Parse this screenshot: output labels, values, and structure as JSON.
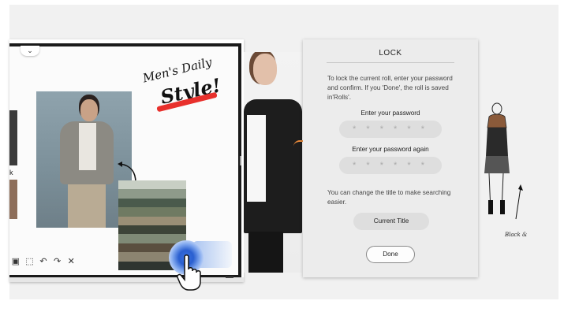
{
  "board": {
    "handwriting_line1": "Men's Daily",
    "handwriting_line2": "Style!",
    "chevron_glyph": "⌄",
    "left_label": "k",
    "toolbar": [
      {
        "icon": "image-icon",
        "glyph": "▣"
      },
      {
        "icon": "select-icon",
        "glyph": "⬚"
      },
      {
        "icon": "undo-icon",
        "glyph": "↶"
      },
      {
        "icon": "redo-icon",
        "glyph": "↷"
      },
      {
        "icon": "close-icon",
        "glyph": "✕"
      }
    ]
  },
  "dialog": {
    "title": "LOCK",
    "description": "To lock the current roll, enter your password and confirm. If you 'Done', the roll is saved in'Rolls'.",
    "password_label": "Enter your password",
    "password_value": "* * * * * *",
    "password_again_label": "Enter your password again",
    "password_again_value": "* * * * * *",
    "note": "You can change the title to make searching easier.",
    "title_button": "Current Title",
    "done_button": "Done"
  },
  "sketch": {
    "label": "Black &"
  },
  "colors": {
    "accent_red": "#e8302c",
    "touch_blue": "#2a5fd0",
    "dialog_bg": "#ececec"
  }
}
